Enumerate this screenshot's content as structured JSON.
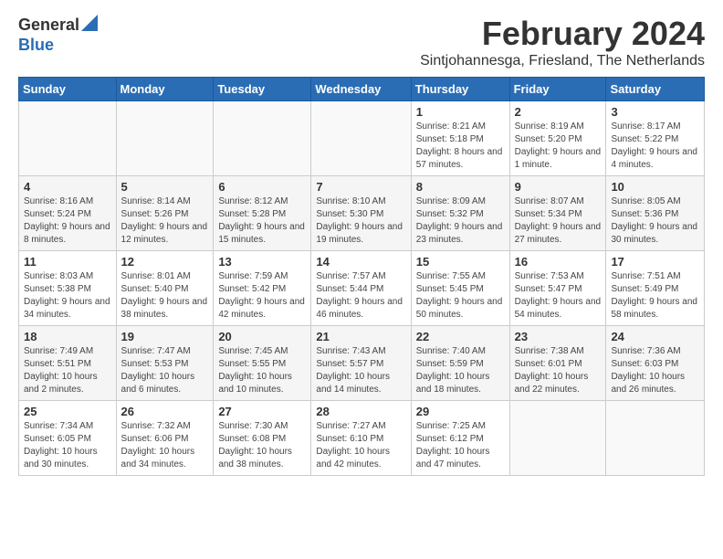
{
  "logo": {
    "general": "General",
    "blue": "Blue"
  },
  "title": "February 2024",
  "location": "Sintjohannesga, Friesland, The Netherlands",
  "days_of_week": [
    "Sunday",
    "Monday",
    "Tuesday",
    "Wednesday",
    "Thursday",
    "Friday",
    "Saturday"
  ],
  "weeks": [
    [
      {
        "day": "",
        "info": ""
      },
      {
        "day": "",
        "info": ""
      },
      {
        "day": "",
        "info": ""
      },
      {
        "day": "",
        "info": ""
      },
      {
        "day": "1",
        "info": "Sunrise: 8:21 AM\nSunset: 5:18 PM\nDaylight: 8 hours and 57 minutes."
      },
      {
        "day": "2",
        "info": "Sunrise: 8:19 AM\nSunset: 5:20 PM\nDaylight: 9 hours and 1 minute."
      },
      {
        "day": "3",
        "info": "Sunrise: 8:17 AM\nSunset: 5:22 PM\nDaylight: 9 hours and 4 minutes."
      }
    ],
    [
      {
        "day": "4",
        "info": "Sunrise: 8:16 AM\nSunset: 5:24 PM\nDaylight: 9 hours and 8 minutes."
      },
      {
        "day": "5",
        "info": "Sunrise: 8:14 AM\nSunset: 5:26 PM\nDaylight: 9 hours and 12 minutes."
      },
      {
        "day": "6",
        "info": "Sunrise: 8:12 AM\nSunset: 5:28 PM\nDaylight: 9 hours and 15 minutes."
      },
      {
        "day": "7",
        "info": "Sunrise: 8:10 AM\nSunset: 5:30 PM\nDaylight: 9 hours and 19 minutes."
      },
      {
        "day": "8",
        "info": "Sunrise: 8:09 AM\nSunset: 5:32 PM\nDaylight: 9 hours and 23 minutes."
      },
      {
        "day": "9",
        "info": "Sunrise: 8:07 AM\nSunset: 5:34 PM\nDaylight: 9 hours and 27 minutes."
      },
      {
        "day": "10",
        "info": "Sunrise: 8:05 AM\nSunset: 5:36 PM\nDaylight: 9 hours and 30 minutes."
      }
    ],
    [
      {
        "day": "11",
        "info": "Sunrise: 8:03 AM\nSunset: 5:38 PM\nDaylight: 9 hours and 34 minutes."
      },
      {
        "day": "12",
        "info": "Sunrise: 8:01 AM\nSunset: 5:40 PM\nDaylight: 9 hours and 38 minutes."
      },
      {
        "day": "13",
        "info": "Sunrise: 7:59 AM\nSunset: 5:42 PM\nDaylight: 9 hours and 42 minutes."
      },
      {
        "day": "14",
        "info": "Sunrise: 7:57 AM\nSunset: 5:44 PM\nDaylight: 9 hours and 46 minutes."
      },
      {
        "day": "15",
        "info": "Sunrise: 7:55 AM\nSunset: 5:45 PM\nDaylight: 9 hours and 50 minutes."
      },
      {
        "day": "16",
        "info": "Sunrise: 7:53 AM\nSunset: 5:47 PM\nDaylight: 9 hours and 54 minutes."
      },
      {
        "day": "17",
        "info": "Sunrise: 7:51 AM\nSunset: 5:49 PM\nDaylight: 9 hours and 58 minutes."
      }
    ],
    [
      {
        "day": "18",
        "info": "Sunrise: 7:49 AM\nSunset: 5:51 PM\nDaylight: 10 hours and 2 minutes."
      },
      {
        "day": "19",
        "info": "Sunrise: 7:47 AM\nSunset: 5:53 PM\nDaylight: 10 hours and 6 minutes."
      },
      {
        "day": "20",
        "info": "Sunrise: 7:45 AM\nSunset: 5:55 PM\nDaylight: 10 hours and 10 minutes."
      },
      {
        "day": "21",
        "info": "Sunrise: 7:43 AM\nSunset: 5:57 PM\nDaylight: 10 hours and 14 minutes."
      },
      {
        "day": "22",
        "info": "Sunrise: 7:40 AM\nSunset: 5:59 PM\nDaylight: 10 hours and 18 minutes."
      },
      {
        "day": "23",
        "info": "Sunrise: 7:38 AM\nSunset: 6:01 PM\nDaylight: 10 hours and 22 minutes."
      },
      {
        "day": "24",
        "info": "Sunrise: 7:36 AM\nSunset: 6:03 PM\nDaylight: 10 hours and 26 minutes."
      }
    ],
    [
      {
        "day": "25",
        "info": "Sunrise: 7:34 AM\nSunset: 6:05 PM\nDaylight: 10 hours and 30 minutes."
      },
      {
        "day": "26",
        "info": "Sunrise: 7:32 AM\nSunset: 6:06 PM\nDaylight: 10 hours and 34 minutes."
      },
      {
        "day": "27",
        "info": "Sunrise: 7:30 AM\nSunset: 6:08 PM\nDaylight: 10 hours and 38 minutes."
      },
      {
        "day": "28",
        "info": "Sunrise: 7:27 AM\nSunset: 6:10 PM\nDaylight: 10 hours and 42 minutes."
      },
      {
        "day": "29",
        "info": "Sunrise: 7:25 AM\nSunset: 6:12 PM\nDaylight: 10 hours and 47 minutes."
      },
      {
        "day": "",
        "info": ""
      },
      {
        "day": "",
        "info": ""
      }
    ]
  ]
}
